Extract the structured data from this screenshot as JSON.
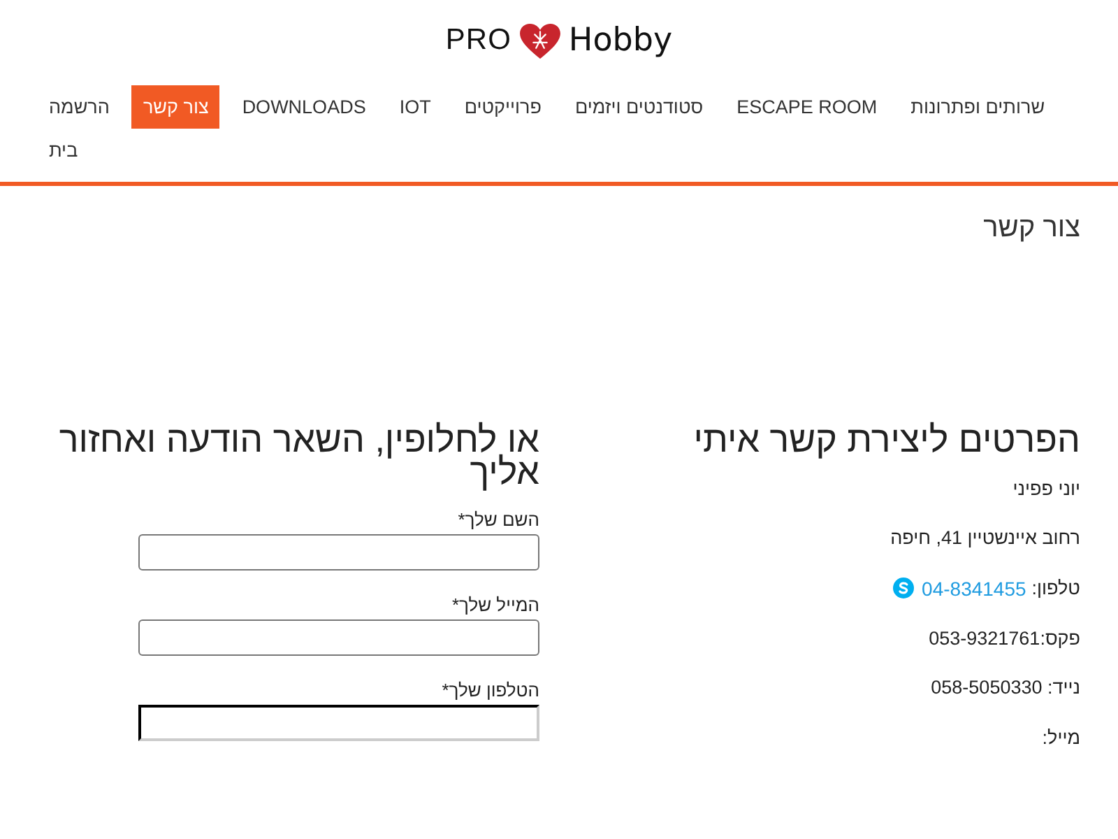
{
  "logo": {
    "text_before": "PRO",
    "text_after": "Hobby"
  },
  "nav": {
    "items": [
      {
        "label": "שרותים ופתרונות",
        "selected": false
      },
      {
        "label": "ESCAPE ROOM",
        "selected": false
      },
      {
        "label": "סטודנטים ויזמים",
        "selected": false
      },
      {
        "label": "פרוייקטים",
        "selected": false
      },
      {
        "label": "IOT",
        "selected": false
      },
      {
        "label": "DOWNLOADS",
        "selected": false
      },
      {
        "label": "צור קשר",
        "selected": true
      },
      {
        "label": "הרשמה",
        "selected": false
      },
      {
        "label": "בית",
        "selected": false
      }
    ]
  },
  "page_title": "צור קשר",
  "contact_details": {
    "heading": "הפרטים ליצירת קשר איתי",
    "lines": [
      {
        "kind": "text",
        "text": "יוני פפיני"
      },
      {
        "kind": "text",
        "text": "רחוב איינשטיין 41, חיפה"
      },
      {
        "kind": "phone",
        "label": "טלפון:",
        "value": "04-8341455"
      },
      {
        "kind": "text",
        "text": "פקס:053-9321761"
      },
      {
        "kind": "text",
        "text": "נייד: 058-5050330"
      },
      {
        "kind": "text",
        "text": "מייל:"
      }
    ]
  },
  "contact_form": {
    "heading": "או לחלופין, השאר הודעה ואחזור אליך",
    "fields": [
      {
        "label": "השם שלך*",
        "kind": "text"
      },
      {
        "label": "המייל שלך*",
        "kind": "email"
      },
      {
        "label": "הטלפון שלך*",
        "kind": "tel"
      }
    ]
  }
}
